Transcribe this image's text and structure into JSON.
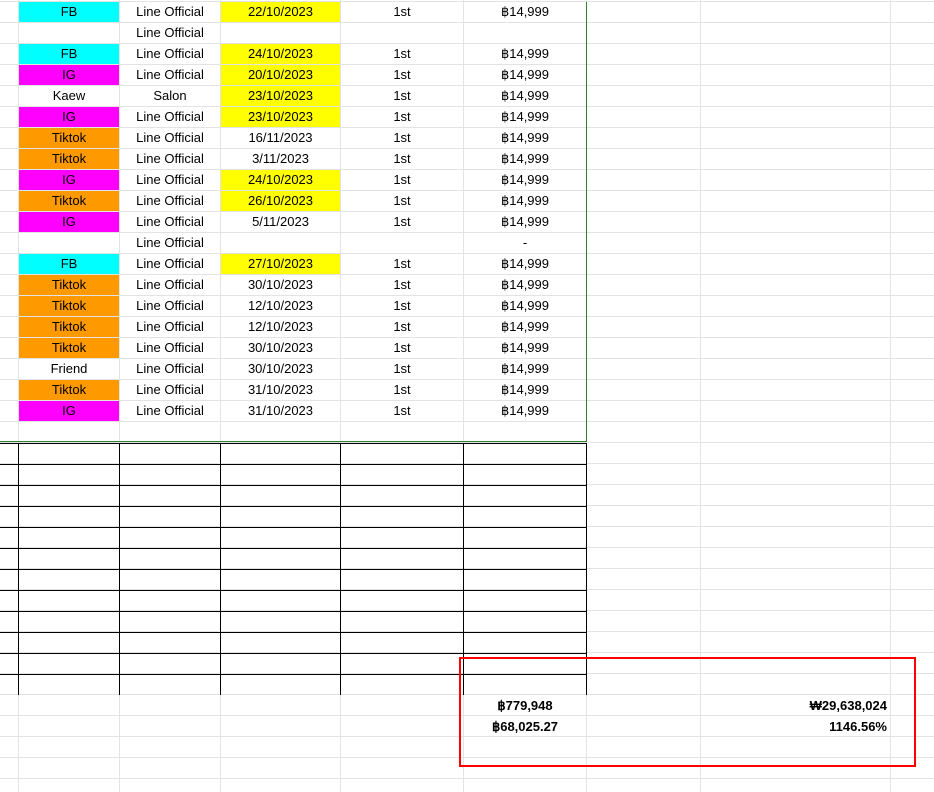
{
  "colors": {
    "FB": "#00ffff",
    "IG": "#ff00ff",
    "Tiktok": "#ff9900",
    "date_highlight": "#ffff00",
    "grid": "#e2e3e3",
    "selection_border": "#2e7d32",
    "annotation_box": "#ff0000"
  },
  "rows": [
    {
      "source": "FB",
      "channel": "Line Official",
      "date": "22/10/2023",
      "round": "1st",
      "amount": "฿14,999",
      "date_hl": true
    },
    {
      "source": "",
      "channel": "Line Official",
      "date": "",
      "round": "",
      "amount": "",
      "date_hl": false
    },
    {
      "source": "FB",
      "channel": "Line Official",
      "date": "24/10/2023",
      "round": "1st",
      "amount": "฿14,999",
      "date_hl": true
    },
    {
      "source": "IG",
      "channel": "Line Official",
      "date": "20/10/2023",
      "round": "1st",
      "amount": "฿14,999",
      "date_hl": true
    },
    {
      "source": "Kaew",
      "channel": "Salon",
      "date": "23/10/2023",
      "round": "1st",
      "amount": "฿14,999",
      "date_hl": true
    },
    {
      "source": "IG",
      "channel": "Line Official",
      "date": "23/10/2023",
      "round": "1st",
      "amount": "฿14,999",
      "date_hl": true
    },
    {
      "source": "Tiktok",
      "channel": "Line Official",
      "date": "16/11/2023",
      "round": "1st",
      "amount": "฿14,999",
      "date_hl": false
    },
    {
      "source": "Tiktok",
      "channel": "Line Official",
      "date": "3/11/2023",
      "round": "1st",
      "amount": "฿14,999",
      "date_hl": false
    },
    {
      "source": "IG",
      "channel": "Line Official",
      "date": "24/10/2023",
      "round": "1st",
      "amount": "฿14,999",
      "date_hl": true
    },
    {
      "source": "Tiktok",
      "channel": "Line Official",
      "date": "26/10/2023",
      "round": "1st",
      "amount": "฿14,999",
      "date_hl": true
    },
    {
      "source": "IG",
      "channel": "Line Official",
      "date": "5/11/2023",
      "round": "1st",
      "amount": "฿14,999",
      "date_hl": false
    },
    {
      "source": "",
      "channel": "Line Official",
      "date": "",
      "round": "",
      "amount": "-",
      "date_hl": false
    },
    {
      "source": "FB",
      "channel": "Line Official",
      "date": "27/10/2023",
      "round": "1st",
      "amount": "฿14,999",
      "date_hl": true
    },
    {
      "source": "Tiktok",
      "channel": "Line Official",
      "date": "30/10/2023",
      "round": "1st",
      "amount": "฿14,999",
      "date_hl": false
    },
    {
      "source": "Tiktok",
      "channel": "Line Official",
      "date": "12/10/2023",
      "round": "1st",
      "amount": "฿14,999",
      "date_hl": false
    },
    {
      "source": "Tiktok",
      "channel": "Line Official",
      "date": "12/10/2023",
      "round": "1st",
      "amount": "฿14,999",
      "date_hl": false
    },
    {
      "source": "Tiktok",
      "channel": "Line Official",
      "date": "30/10/2023",
      "round": "1st",
      "amount": "฿14,999",
      "date_hl": false
    },
    {
      "source": "Friend",
      "channel": "Line Official",
      "date": "30/10/2023",
      "round": "1st",
      "amount": "฿14,999",
      "date_hl": false
    },
    {
      "source": "Tiktok",
      "channel": "Line Official",
      "date": "31/10/2023",
      "round": "1st",
      "amount": "฿14,999",
      "date_hl": false
    },
    {
      "source": "IG",
      "channel": "Line Official",
      "date": "31/10/2023",
      "round": "1st",
      "amount": "฿14,999",
      "date_hl": false
    }
  ],
  "summary": {
    "total_thb": "฿779,948",
    "total_krw": "₩29,638,024",
    "converted_thb": "฿68,025.27",
    "percent": "1146.56%"
  }
}
